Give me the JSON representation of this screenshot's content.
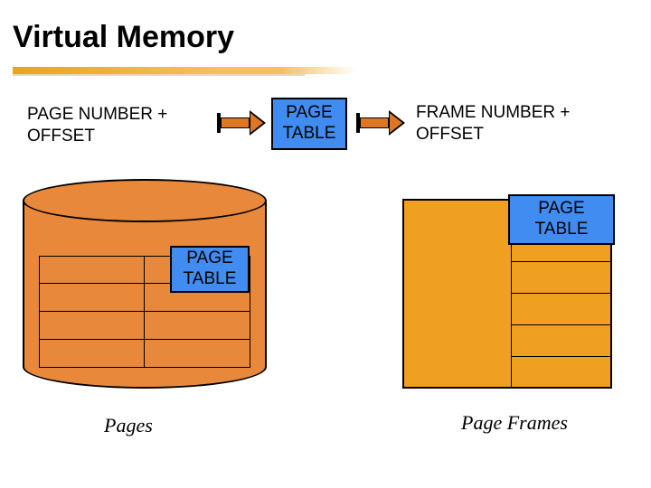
{
  "title": "Virtual Memory",
  "labels": {
    "input": "PAGE NUMBER +\n OFFSET",
    "output": "FRAME NUMBER +\n OFFSET",
    "center_box": "PAGE\nTABLE",
    "cyl_box": "PAGE\nTABLE",
    "frame_box": "PAGE\nTABLE"
  },
  "captions": {
    "pages": "Pages",
    "frames": "Page Frames"
  },
  "colors": {
    "orange_fill": "#e8883a",
    "gold": "#f0a020",
    "blue": "#418cf0",
    "arrow_fill": "#df7722"
  }
}
